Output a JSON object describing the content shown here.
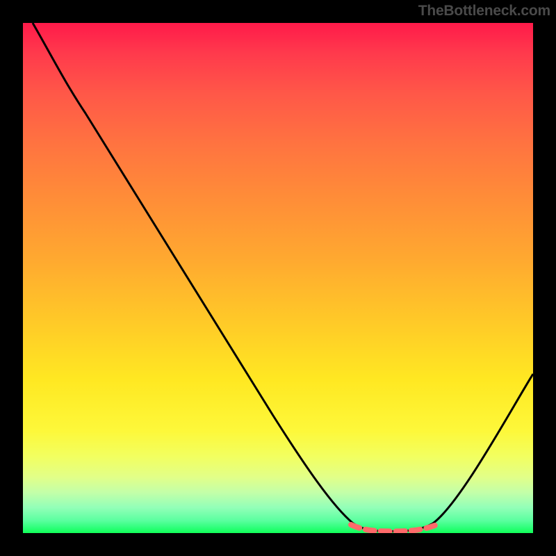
{
  "watermark": "TheBottleneck.com",
  "chart_data": {
    "type": "line",
    "title": "",
    "xlabel": "",
    "ylabel": "",
    "xlim": [
      0,
      100
    ],
    "ylim": [
      0,
      100
    ],
    "series": [
      {
        "name": "curve",
        "color": "#000000",
        "points": [
          {
            "x": 2,
            "y": 100
          },
          {
            "x": 8,
            "y": 92
          },
          {
            "x": 14,
            "y": 82
          },
          {
            "x": 20,
            "y": 72
          },
          {
            "x": 28,
            "y": 59
          },
          {
            "x": 36,
            "y": 46
          },
          {
            "x": 44,
            "y": 33
          },
          {
            "x": 52,
            "y": 20
          },
          {
            "x": 58,
            "y": 10
          },
          {
            "x": 63,
            "y": 3
          },
          {
            "x": 66,
            "y": 1
          },
          {
            "x": 70,
            "y": 0.3
          },
          {
            "x": 76,
            "y": 0.3
          },
          {
            "x": 80,
            "y": 1
          },
          {
            "x": 84,
            "y": 3
          },
          {
            "x": 90,
            "y": 13
          },
          {
            "x": 96,
            "y": 24
          },
          {
            "x": 100,
            "y": 31
          }
        ]
      },
      {
        "name": "highlight",
        "color": "#ff6a6a",
        "points": [
          {
            "x": 65,
            "y": 1.2
          },
          {
            "x": 67,
            "y": 0.6
          },
          {
            "x": 70,
            "y": 0.3
          },
          {
            "x": 74,
            "y": 0.3
          },
          {
            "x": 78,
            "y": 0.5
          },
          {
            "x": 81,
            "y": 1.2
          }
        ]
      }
    ],
    "background_gradient": {
      "top_color": "#ff1a4a",
      "mid_color": "#ffe822",
      "bottom_color": "#11ff58"
    }
  }
}
